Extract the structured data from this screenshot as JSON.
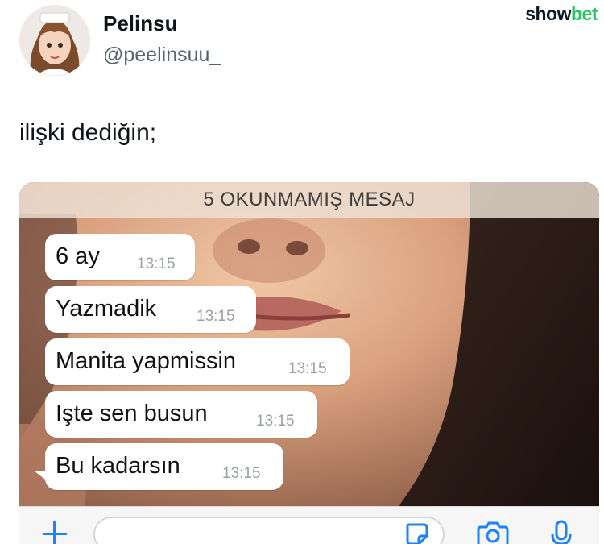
{
  "tweet": {
    "display_name": "Pelinsu",
    "handle": "@peelinsuu_",
    "text": "ilişki dediğin;"
  },
  "brand": {
    "part1": "show",
    "part2": "bet",
    "color_dark": "#0d1a26",
    "color_green": "#22c55e"
  },
  "chat": {
    "banner": "5 OKUNMAMIŞ MESAJ",
    "messages": [
      {
        "text": "6 ay",
        "time": "13:15"
      },
      {
        "text": "Yazmadik",
        "time": "13:15"
      },
      {
        "text": "Manita yapmissin",
        "time": "13:15"
      },
      {
        "text": "Işte sen busun",
        "time": "13:15"
      },
      {
        "text": "Bu kadarsın",
        "time": "13:15"
      }
    ],
    "input_icons": [
      "plus-icon",
      "sticker-icon",
      "camera-icon",
      "microphone-icon"
    ],
    "accent": "#1d82f5"
  }
}
